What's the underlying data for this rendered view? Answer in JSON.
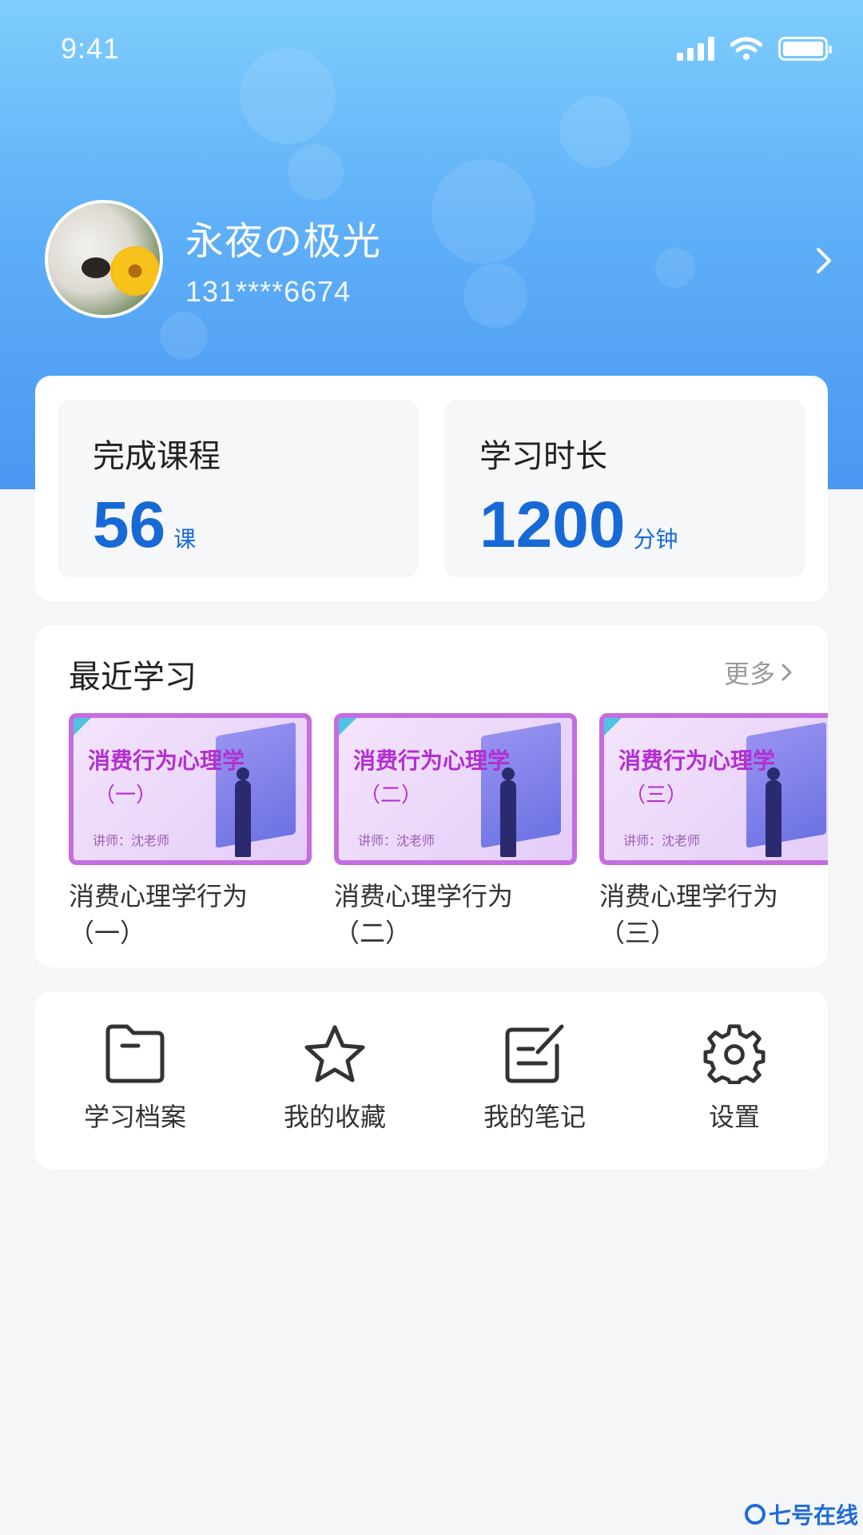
{
  "status_bar": {
    "time": "9:41"
  },
  "profile": {
    "name": "永夜の极光",
    "phone": "131****6674"
  },
  "stats": {
    "completed": {
      "label": "完成课程",
      "value": "56",
      "unit": "课"
    },
    "duration": {
      "label": "学习时长",
      "value": "1200",
      "unit": "分钟"
    }
  },
  "recent": {
    "title": "最近学习",
    "more": "更多",
    "courses": [
      {
        "thumb_title": "消费行为心理学",
        "thumb_num": "（一）",
        "teacher": "讲师：沈老师",
        "name": "消费心理学行为（一）"
      },
      {
        "thumb_title": "消费行为心理学",
        "thumb_num": "（二）",
        "teacher": "讲师：沈老师",
        "name": "消费心理学行为（二）"
      },
      {
        "thumb_title": "消费行为心理学",
        "thumb_num": "（三）",
        "teacher": "讲师：沈老师",
        "name": "消费心理学行为（三）"
      }
    ]
  },
  "menu": [
    {
      "label": "学习档案",
      "icon": "folder-icon"
    },
    {
      "label": "我的收藏",
      "icon": "star-icon"
    },
    {
      "label": "我的笔记",
      "icon": "note-icon"
    },
    {
      "label": "设置",
      "icon": "gear-icon"
    }
  ],
  "watermark": {
    "text": "七号在线"
  },
  "colors": {
    "accent": "#1769d6",
    "header_top": "#7ecdfd",
    "header_bottom": "#4a97f2",
    "thumb_border": "#c36de0"
  }
}
